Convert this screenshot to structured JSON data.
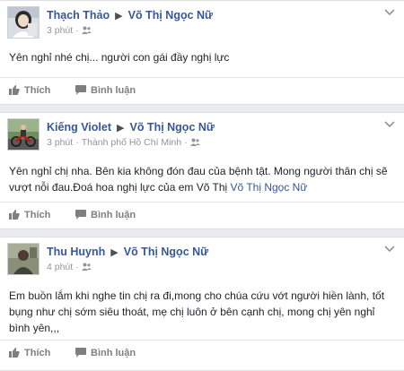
{
  "posts": [
    {
      "author": "Thạch Thảo",
      "target": "Võ Thị Ngọc Nữ",
      "time": "3 phút",
      "location": "",
      "content": "Yên nghỉ nhé chị... người con gái đầy nghị lực",
      "mention": "",
      "avatar_icon": "profile-photo-girl"
    },
    {
      "author": "Kiếng Violet",
      "target": "Võ Thị Ngọc Nữ",
      "time": "3 phút",
      "location": "Thành phố Hồ Chí Minh",
      "content": "Yên nghỉ chị nha. Bên kia không đón đau của bệnh tật. Mong người thân chị sẽ vượt nỗi đau.Đoá hoa nghị lực của em Võ Thị",
      "mention": "Võ Thị Ngọc Nữ",
      "avatar_icon": "profile-photo-motorbike"
    },
    {
      "author": "Thu Huynh",
      "target": "Võ Thị Ngọc Nữ",
      "time": "4 phút",
      "location": "",
      "content": "Em buồn lắm khi nghe tin chị ra đi,mong cho chúa cứu vớt người hiền lành, tốt bụng như chị sớm siêu thoát, mẹ chị luôn ở bên cạnh chị, mong chị yên nghỉ bình yên,,,",
      "mention": "",
      "avatar_icon": "profile-photo-person"
    }
  ],
  "actions": {
    "like_label": "Thích",
    "comment_label": "Bình luận"
  },
  "colors": {
    "name_link": "#365899",
    "meta_text": "#90949c",
    "background": "#e9ebee"
  }
}
